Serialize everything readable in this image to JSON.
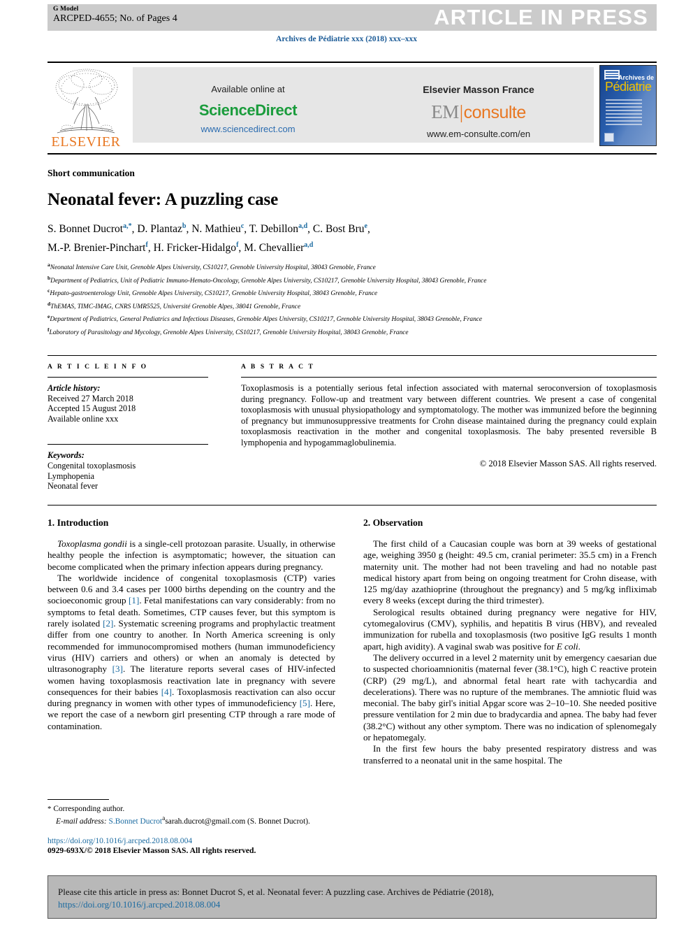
{
  "banner": {
    "g_model": "G Model",
    "manuscript_id": "ARCPED-4655; No. of Pages 4",
    "status": "ARTICLE IN PRESS"
  },
  "journal_line": "Archives de Pédiatrie xxx (2018) xxx–xxx",
  "masthead": {
    "elsevier_wordmark": "ELSEVIER",
    "sciencedirect_panel": {
      "available_label": "Available online at",
      "brand": "ScienceDirect",
      "url": "www.sciencedirect.com"
    },
    "emconsulte_panel": {
      "publisher": "Elsevier Masson France",
      "brand_prefix": "EM",
      "brand_suffix": "consulte",
      "url": "www.em-consulte.com/en"
    },
    "cover": {
      "line1": "Archives de",
      "line2": "Pédiatrie"
    }
  },
  "article": {
    "type": "Short communication",
    "title": "Neonatal fever: A puzzling case",
    "authors_line1_parts": [
      {
        "name": "S. Bonnet Ducrot",
        "sup": "a,*"
      },
      {
        "name": "D. Plantaz",
        "sup": "b"
      },
      {
        "name": "N. Mathieu",
        "sup": "c"
      },
      {
        "name": "T. Debillon",
        "sup": "a,d"
      },
      {
        "name": "C. Bost Bru",
        "sup": "e"
      }
    ],
    "authors_line2_parts": [
      {
        "name": "M.-P. Brenier-Pinchart",
        "sup": "f"
      },
      {
        "name": "H. Fricker-Hidalgo",
        "sup": "f"
      },
      {
        "name": "M. Chevallier",
        "sup": "a,d"
      }
    ],
    "affiliations": [
      {
        "mark": "a",
        "text": "Neonatal Intensive Care Unit, Grenoble Alpes University, CS10217, Grenoble University Hospital, 38043 Grenoble, France"
      },
      {
        "mark": "b",
        "text": "Department of Pediatrics, Unit of Pediatric Immuno-Hemato-Oncology, Grenoble Alpes University, CS10217, Grenoble University Hospital, 38043 Grenoble, France"
      },
      {
        "mark": "c",
        "text": "Hepato-gastroenterology Unit, Grenoble Alpes University, CS10217, Grenoble University Hospital, 38043 Grenoble, France"
      },
      {
        "mark": "d",
        "text": "ThEMAS, TIMC-IMAG, CNRS UMR5525, Université Grenoble Alpes, 38041 Grenoble, France"
      },
      {
        "mark": "e",
        "text": "Department of Pediatrics, General Pediatrics and Infectious Diseases, Grenoble Alpes University, CS10217, Grenoble University Hospital, 38043 Grenoble, France"
      },
      {
        "mark": "f",
        "text": "Laboratory of Parasitology and Mycology, Grenoble Alpes University, CS10217, Grenoble University Hospital, 38043 Grenoble, France"
      }
    ]
  },
  "article_info": {
    "heading": "A R T I C L E   I N F O",
    "history_label": "Article history:",
    "history": [
      "Received 27 March 2018",
      "Accepted 15 August 2018",
      "Available online xxx"
    ],
    "keywords_label": "Keywords:",
    "keywords": [
      "Congenital toxoplasmosis",
      "Lymphopenia",
      "Neonatal fever"
    ]
  },
  "abstract": {
    "heading": "A B S T R A C T",
    "text": "Toxoplasmosis is a potentially serious fetal infection associated with maternal seroconversion of toxoplasmosis during pregnancy. Follow-up and treatment vary between different countries. We present a case of congenital toxoplasmosis with unusual physiopathology and symptomatology. The mother was immunized before the beginning of pregnancy but immunosuppressive treatments for Crohn disease maintained during the pregnancy could explain toxoplasmosis reactivation in the mother and congenital toxoplasmosis. The baby presented reversible B lymphopenia and hypogammaglobulinemia.",
    "copyright": "© 2018 Elsevier Masson SAS. All rights reserved."
  },
  "body": {
    "section1_heading": "1. Introduction",
    "section1_paragraphs": [
      "Toxoplasma gondii is a single-cell protozoan parasite. Usually, in otherwise healthy people the infection is asymptomatic; however, the situation can become complicated when the primary infection appears during pregnancy.",
      "The worldwide incidence of congenital toxoplasmosis (CTP) varies between 0.6 and 3.4 cases per 1000 births depending on the country and the socioeconomic group [1]. Fetal manifestations can vary considerably: from no symptoms to fetal death. Sometimes, CTP causes fever, but this symptom is rarely isolated [2]. Systematic screening programs and prophylactic treatment differ from one country to another. In North America screening is only recommended for immunocompromised mothers (human immunodeficiency virus (HIV) carriers and others) or when an anomaly is detected by ultrasonography [3]. The literature reports several cases of HIV-infected women having toxoplasmosis reactivation late in pregnancy with severe consequences for their babies [4]. Toxoplasmosis reactivation can also occur during pregnancy in women with other types of immunodeficiency [5]. Here, we report the case of a newborn girl presenting CTP through a rare mode of contamination."
    ],
    "section2_heading": "2. Observation",
    "section2_paragraphs": [
      "The first child of a Caucasian couple was born at 39 weeks of gestational age, weighing 3950 g (height: 49.5 cm, cranial perimeter: 35.5 cm) in a French maternity unit. The mother had not been traveling and had no notable past medical history apart from being on ongoing treatment for Crohn disease, with 125 mg/day azathioprine (throughout the pregnancy) and 5 mg/kg infliximab every 8 weeks (except during the third trimester).",
      "Serological results obtained during pregnancy were negative for HIV, cytomegalovirus (CMV), syphilis, and hepatitis B virus (HBV), and revealed immunization for rubella and toxoplasmosis (two positive IgG results 1 month apart, high avidity). A vaginal swab was positive for E coli.",
      "The delivery occurred in a level 2 maternity unit by emergency caesarian due to suspected chorioamnionitis (maternal fever (38.1°C), high C reactive protein (CRP) (29 mg/L), and abnormal fetal heart rate with tachycardia and decelerations). There was no rupture of the membranes. The amniotic fluid was meconial. The baby girl's initial Apgar score was 2–10–10. She needed positive pressure ventilation for 2 min due to bradycardia and apnea. The baby had fever (38.2°C) without any other symptom. There was no indication of splenomegaly or hepatomegaly.",
      "In the first few hours the baby presented respiratory distress and was transferred to a neonatal unit in the same hospital. The"
    ]
  },
  "footnote": {
    "corresponding_marker": "*",
    "corresponding_label": "Corresponding author.",
    "email_label": "E-mail address:",
    "email_link": "S.Bonnet Ducrot",
    "email_rest": "sarah.ducrot@gmail.com (S. Bonnet Ducrot).",
    "doi": "https://doi.org/10.1016/j.arcped.2018.08.004",
    "issn_line": "0929-693X/© 2018 Elsevier Masson SAS. All rights reserved."
  },
  "cite_box": {
    "prefix": "Please cite this article in press as: Bonnet Ducrot S, et al. Neonatal fever: A puzzling case. Archives de Pédiatrie (2018), ",
    "link": "https://doi.org/10.1016/j.arcped.2018.08.004"
  },
  "colors": {
    "journal_blue": "#1a5a96",
    "link_blue": "#1a6aa0",
    "elsevier_orange": "#E87722",
    "sciencedirect_green": "#1a9c3c",
    "banner_grey": "#cbcbcb",
    "panel_grey": "#e6e6e6",
    "cite_grey": "#b8b8b8"
  }
}
